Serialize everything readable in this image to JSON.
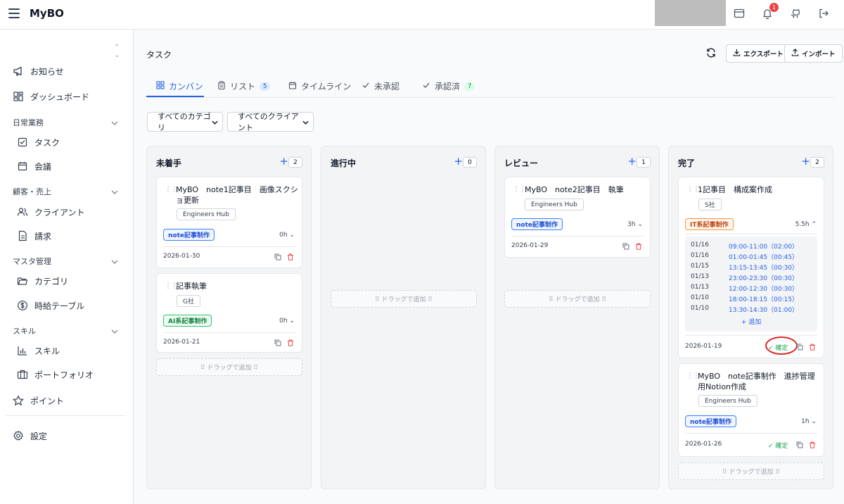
{
  "app": {
    "title": "MyBO",
    "notification_count": "1"
  },
  "sidebar": {
    "news": "お知らせ",
    "dashboard": "ダッシュボード",
    "group_daily": "日常業務",
    "task": "タスク",
    "meeting": "会議",
    "group_customer": "顧客・売上",
    "client": "クライアント",
    "invoice": "請求",
    "group_master": "マスタ管理",
    "category": "カテゴリ",
    "hourly": "時給テーブル",
    "group_skill": "スキル",
    "skill": "スキル",
    "portfolio": "ポートフォリオ",
    "points": "ポイント",
    "settings": "設定"
  },
  "main": {
    "title": "タスク",
    "export_label": "エクスポート",
    "import_label": "インポート",
    "tabs": [
      {
        "label": "カンバン",
        "count": ""
      },
      {
        "label": "リスト",
        "count": "5"
      },
      {
        "label": "タイムライン",
        "count": ""
      },
      {
        "label": "未承認",
        "count": ""
      },
      {
        "label": "承認済",
        "count": "7"
      }
    ],
    "filter_category": "すべてのカテゴリ",
    "filter_client": "すべてのクライアント",
    "drag_label": "⠿ ドラッグで追加 ⠿",
    "confirm_label": "✓ 確定",
    "add_label": "+ 追加"
  },
  "columns": [
    {
      "title": "未着手",
      "count": "2",
      "cards": [
        {
          "title": "MyBO　note1記事目　画像スクショ更新",
          "client": "Engineers Hub",
          "category": "note記事制作",
          "hours": "0h",
          "date": "2026-01-30"
        },
        {
          "title": "記事執筆",
          "client": "G社",
          "category": "AI系記事制作",
          "hours": "0h",
          "date": "2026-01-21"
        }
      ]
    },
    {
      "title": "進行中",
      "count": "0",
      "cards": []
    },
    {
      "title": "レビュー",
      "count": "1",
      "cards": [
        {
          "title": "MyBO　note2記事目　執筆",
          "client": "Engineers Hub",
          "category": "note記事制作",
          "hours": "3h",
          "date": "2026-01-29"
        }
      ]
    },
    {
      "title": "完了",
      "count": "2",
      "cards": [
        {
          "title": "1記事目　構成案作成",
          "client": "S社",
          "category": "IT系記事制作",
          "hours": "5.5h",
          "date": "2026-01-19",
          "logs": [
            {
              "date": "01/16",
              "time": "09:00-11:00（02:00）"
            },
            {
              "date": "01/16",
              "time": "01:00-01:45（00:45）"
            },
            {
              "date": "01/15",
              "time": "13:15-13:45（00:30）"
            },
            {
              "date": "01/13",
              "time": "23:00-23:30（00:30）"
            },
            {
              "date": "01/13",
              "time": "12:00-12:30（00:30）"
            },
            {
              "date": "01/10",
              "time": "18:00-18:15（00:15）"
            },
            {
              "date": "01/10",
              "time": "13:30-14:30（01:00）"
            }
          ]
        },
        {
          "title": "MyBO　note記事制作　進捗管理用Notion作成",
          "client": "Engineers Hub",
          "category": "note記事制作",
          "hours": "1h",
          "date": "2026-01-26"
        }
      ]
    }
  ]
}
